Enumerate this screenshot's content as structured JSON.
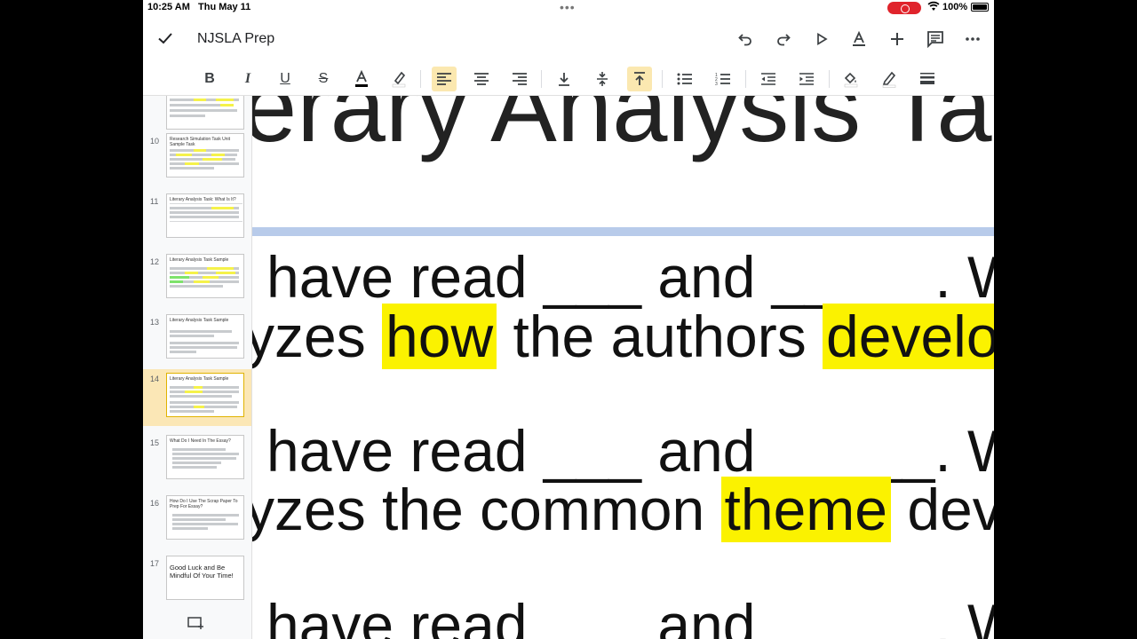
{
  "status_bar": {
    "time": "10:25 AM",
    "date": "Thu May 11",
    "battery": "100%"
  },
  "app_bar": {
    "title": "NJSLA Prep",
    "icons": [
      "check-icon",
      "undo-icon",
      "redo-icon",
      "present-icon",
      "text-color-icon",
      "add-icon",
      "comment-icon",
      "more-icon"
    ]
  },
  "format_bar": {
    "buttons": [
      "bold",
      "italic",
      "underline",
      "strikethrough",
      "text-color",
      "highlight",
      "align-left",
      "align-center",
      "align-right",
      "valign-bottom",
      "valign-middle",
      "valign-top",
      "bulleted-list",
      "numbered-list",
      "decrease-indent",
      "increase-indent",
      "fill-color",
      "border-color",
      "border-weight"
    ],
    "bold_label": "B",
    "italic_label": "I",
    "underline_label": "U",
    "strike_label": "S",
    "textcolor_label": "A"
  },
  "slides": [
    {
      "number": "10",
      "title": "Research Simulation Task Unit Sample Task"
    },
    {
      "number": "11",
      "title": "Literary Analysis Task: What Is It?"
    },
    {
      "number": "12",
      "title": "Literary Analysis Task Sample"
    },
    {
      "number": "13",
      "title": "Literary Analysis Task Sample"
    },
    {
      "number": "14",
      "title": "Literary Analysis Task Sample",
      "selected": true
    },
    {
      "number": "15",
      "title": "What Do I Need In The Essay?"
    },
    {
      "number": "16",
      "title": "How Do I Use The Scrap Paper To Prep For Essay?"
    },
    {
      "number": "17",
      "title": "Good Luck and Be Mindful Of Your Time!"
    }
  ],
  "canvas": {
    "heading": "erary Analysis Task",
    "para1_line1": "have read ___ and _____. W",
    "para1_line2_a": "yzes ",
    "para1_line2_hl1": "how",
    "para1_line2_b": " the authors ",
    "para1_line2_hl2": "develo",
    "para2_line1": "have read ___ and _____. W",
    "para2_line2_a": "yzes the common ",
    "para2_line2_hl": "theme",
    "para2_line2_b": " dev",
    "para3_line1": "have read ___ and _____. W"
  },
  "colors": {
    "highlight": "#fbf200",
    "selected_slide": "#fbe7b6",
    "active_format": "#fbe8b0",
    "record_indicator": "#e0242c"
  }
}
